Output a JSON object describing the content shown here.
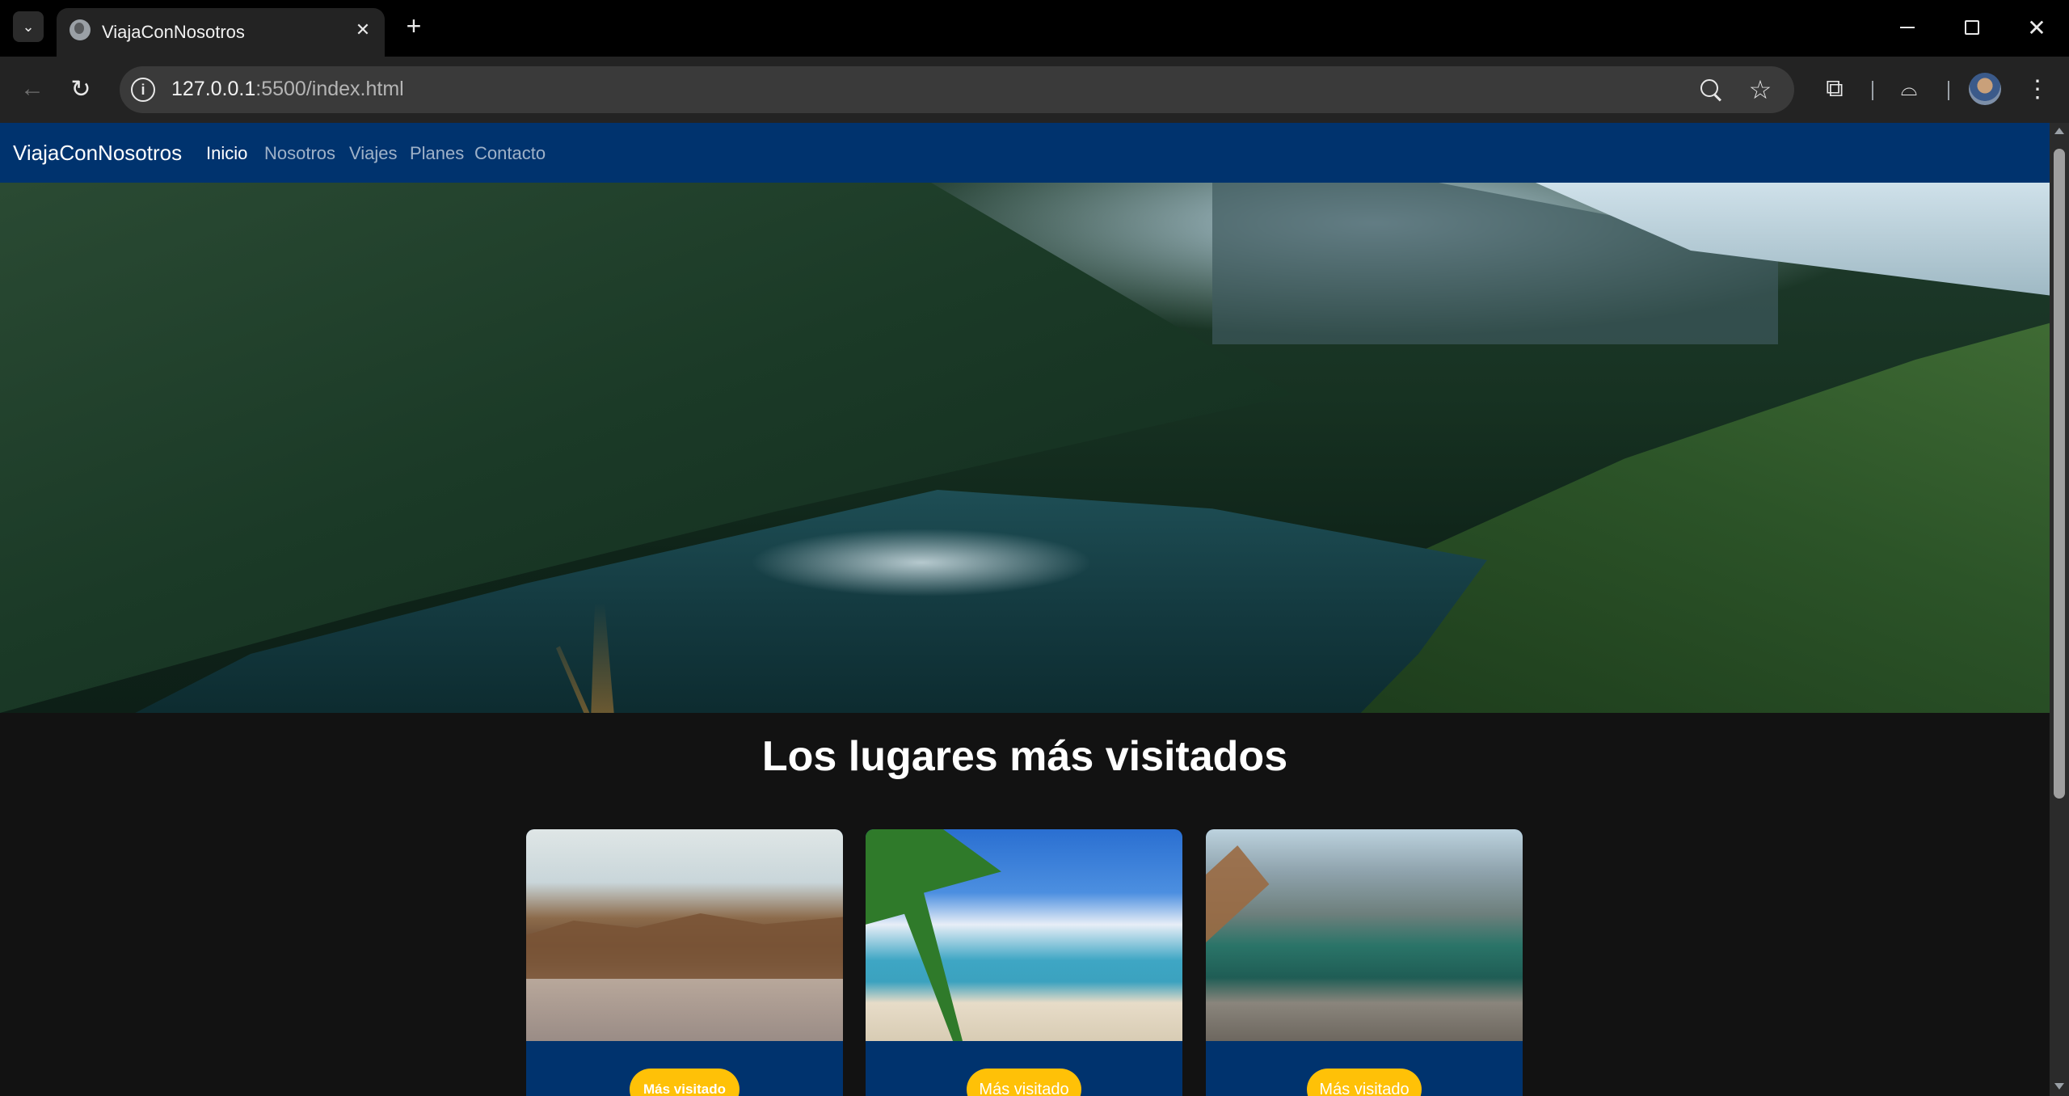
{
  "browser": {
    "tab_title": "ViajaConNosotros",
    "url_host": "127.0.0.1",
    "url_path": ":5500/index.html",
    "icons": [
      "tab-search-icon",
      "globe-icon",
      "close-icon",
      "plus-icon",
      "minimize-icon",
      "restore-icon",
      "back-icon",
      "reload-icon",
      "info-icon",
      "zoom-icon",
      "star-icon",
      "extensions-icon",
      "incognito-icon",
      "profile-avatar",
      "kebab-menu-icon"
    ]
  },
  "site": {
    "brand": "ViajaConNosotros",
    "nav": [
      "Inicio",
      "Nosotros",
      "Viajes",
      "Planes",
      "Contacto"
    ],
    "active_nav": "Inicio",
    "section_title": "Los lugares más visitados",
    "cards": [
      {
        "badge": "Más visitado"
      },
      {
        "badge": "Más visitado"
      },
      {
        "badge": "Más visitado"
      }
    ]
  },
  "colors": {
    "navbar": "#00336e",
    "badge": "#ffc107",
    "page_bg": "#121212"
  }
}
